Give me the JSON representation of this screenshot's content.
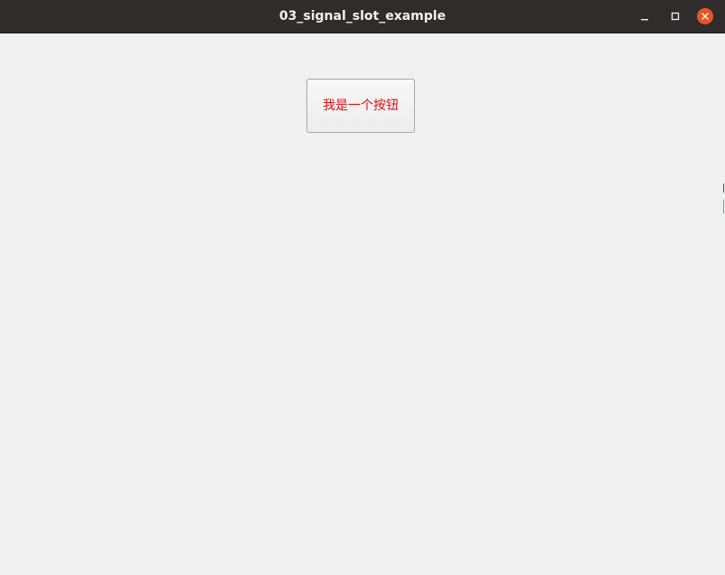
{
  "window": {
    "title": "03_signal_slot_example",
    "controls": {
      "minimize_icon": "minimize-icon",
      "maximize_icon": "maximize-icon",
      "close_icon": "close-icon"
    },
    "colors": {
      "titlebar_bg": "#2f2c2b",
      "close_button": "#e95420",
      "client_bg": "#f0f0f0"
    }
  },
  "main": {
    "button_label": "我是一个按钮",
    "button_text_color": "#e2120f"
  }
}
